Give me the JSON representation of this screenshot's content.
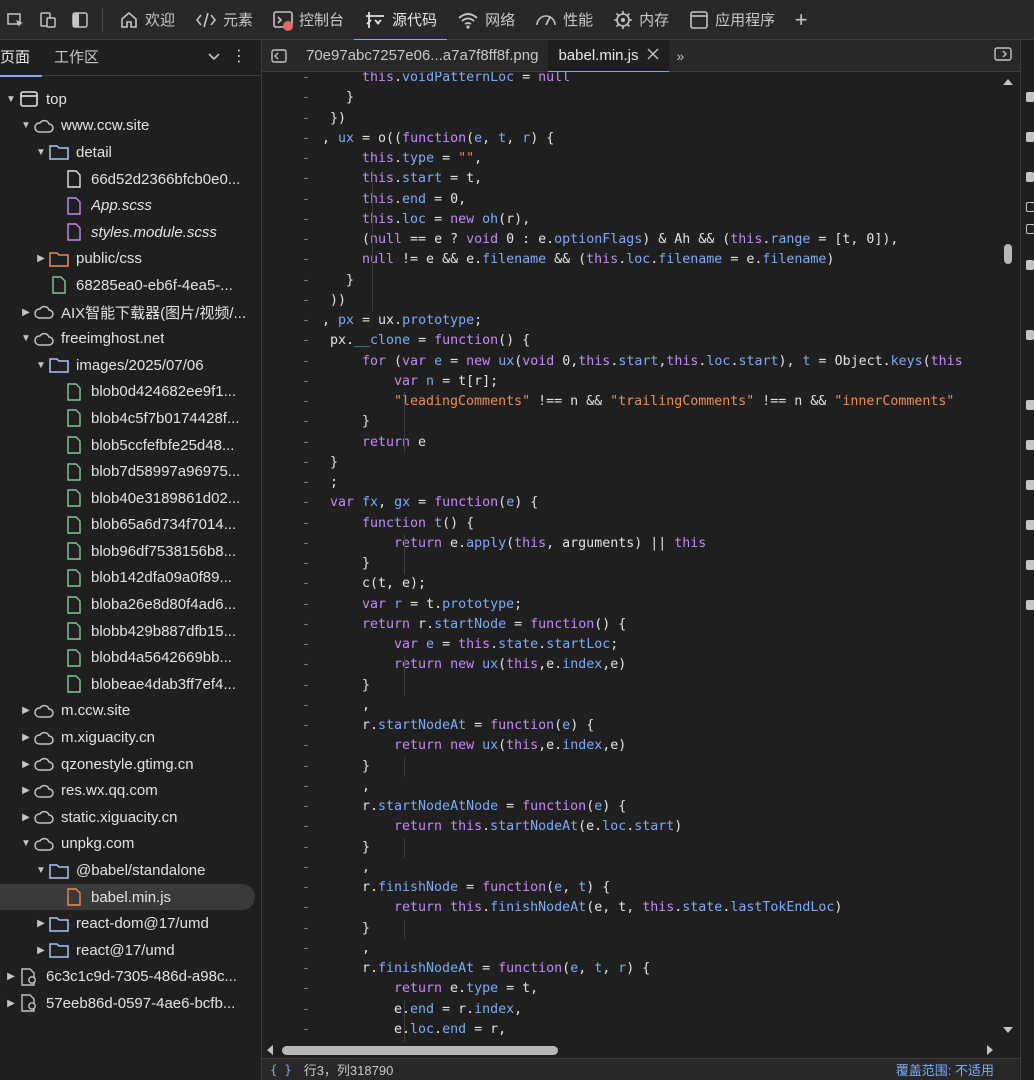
{
  "toolbar": {
    "tabs": [
      {
        "label": "欢迎",
        "icon": "home-icon"
      },
      {
        "label": "元素",
        "icon": "code-icon"
      },
      {
        "label": "控制台",
        "icon": "console-icon"
      },
      {
        "label": "源代码",
        "icon": "sources-icon",
        "active": true
      },
      {
        "label": "网络",
        "icon": "wifi-icon"
      },
      {
        "label": "性能",
        "icon": "performance-icon"
      },
      {
        "label": "内存",
        "icon": "memory-icon"
      },
      {
        "label": "应用程序",
        "icon": "application-icon"
      }
    ],
    "add_label": "+"
  },
  "navigator": {
    "tab_page": "页面",
    "tab_workspace": "工作区",
    "tree": [
      {
        "level": 0,
        "arrow": "open",
        "icon": "frame",
        "label": "top"
      },
      {
        "level": 1,
        "arrow": "open",
        "icon": "cloud",
        "label": "www.ccw.site"
      },
      {
        "level": 2,
        "arrow": "open",
        "icon": "folder",
        "label": "detail"
      },
      {
        "level": 3,
        "arrow": "",
        "icon": "file-white",
        "label": "66d52d2366bfcb0e0..."
      },
      {
        "level": 3,
        "arrow": "",
        "icon": "file-purple",
        "label": "App.scss",
        "italic": true
      },
      {
        "level": 3,
        "arrow": "",
        "icon": "file-purple",
        "label": "styles.module.scss",
        "italic": true
      },
      {
        "level": 2,
        "arrow": "closed",
        "icon": "folder-orange",
        "label": "public/css"
      },
      {
        "level": 2,
        "arrow": "",
        "icon": "file-green",
        "label": "68285ea0-eb6f-4ea5-..."
      },
      {
        "level": 1,
        "arrow": "closed",
        "icon": "cloud",
        "label": "AIX智能下载器(图片/视频/..."
      },
      {
        "level": 1,
        "arrow": "open",
        "icon": "cloud",
        "label": "freeimghost.net"
      },
      {
        "level": 2,
        "arrow": "open",
        "icon": "folder",
        "label": "images/2025/07/06"
      },
      {
        "level": 3,
        "arrow": "",
        "icon": "file-green",
        "label": "blob0d424682ee9f1..."
      },
      {
        "level": 3,
        "arrow": "",
        "icon": "file-green",
        "label": "blob4c5f7b0174428f..."
      },
      {
        "level": 3,
        "arrow": "",
        "icon": "file-green",
        "label": "blob5ccfefbfe25d48..."
      },
      {
        "level": 3,
        "arrow": "",
        "icon": "file-green",
        "label": "blob7d58997a96975..."
      },
      {
        "level": 3,
        "arrow": "",
        "icon": "file-green",
        "label": "blob40e3189861d02..."
      },
      {
        "level": 3,
        "arrow": "",
        "icon": "file-green",
        "label": "blob65a6d734f7014..."
      },
      {
        "level": 3,
        "arrow": "",
        "icon": "file-green",
        "label": "blob96df7538156b8..."
      },
      {
        "level": 3,
        "arrow": "",
        "icon": "file-green",
        "label": "blob142dfa09a0f89..."
      },
      {
        "level": 3,
        "arrow": "",
        "icon": "file-green",
        "label": "bloba26e8d80f4ad6..."
      },
      {
        "level": 3,
        "arrow": "",
        "icon": "file-green",
        "label": "blobb429b887dfb15..."
      },
      {
        "level": 3,
        "arrow": "",
        "icon": "file-green",
        "label": "blobd4a5642669bb..."
      },
      {
        "level": 3,
        "arrow": "",
        "icon": "file-green",
        "label": "blobeae4dab3ff7ef4..."
      },
      {
        "level": 1,
        "arrow": "closed",
        "icon": "cloud",
        "label": "m.ccw.site"
      },
      {
        "level": 1,
        "arrow": "closed",
        "icon": "cloud",
        "label": "m.xiguacity.cn"
      },
      {
        "level": 1,
        "arrow": "closed",
        "icon": "cloud",
        "label": "qzonestyle.gtimg.cn"
      },
      {
        "level": 1,
        "arrow": "closed",
        "icon": "cloud",
        "label": "res.wx.qq.com"
      },
      {
        "level": 1,
        "arrow": "closed",
        "icon": "cloud",
        "label": "static.xiguacity.cn"
      },
      {
        "level": 1,
        "arrow": "open",
        "icon": "cloud",
        "label": "unpkg.com"
      },
      {
        "level": 2,
        "arrow": "open",
        "icon": "folder",
        "label": "@babel/standalone"
      },
      {
        "level": 3,
        "arrow": "",
        "icon": "file-orange",
        "label": "babel.min.js",
        "selected": true
      },
      {
        "level": 2,
        "arrow": "closed",
        "icon": "folder",
        "label": "react-dom@17/umd"
      },
      {
        "level": 2,
        "arrow": "closed",
        "icon": "folder",
        "label": "react@17/umd"
      },
      {
        "level": 0,
        "arrow": "closed",
        "icon": "gear-file",
        "label": "6c3c1c9d-7305-486d-a98c..."
      },
      {
        "level": 0,
        "arrow": "closed",
        "icon": "gear-file",
        "label": "57eeb86d-0597-4ae6-bcfb..."
      }
    ]
  },
  "editor": {
    "tabs": [
      {
        "label": "70e97abc7257e06...a7a7f8ff8f.png",
        "active": false
      },
      {
        "label": "babel.min.js",
        "active": true,
        "closable": true
      }
    ],
    "more_label": "»",
    "gutter_mark": "-",
    "lines": [
      {
        "indent": 8,
        "html": "<span class='th'>this</span>.<span class='pr'>voidPatternLoc</span> = <span class='kw'>null</span>"
      },
      {
        "indent": 6,
        "html": "}"
      },
      {
        "indent": 4,
        "html": "})"
      },
      {
        "indent": 3,
        "html": ", <span class='pr'>ux</span> = o((<span class='kw'>function</span>(<span class='pr'>e</span>, <span class='pr'>t</span>, <span class='pr'>r</span>) {"
      },
      {
        "indent": 8,
        "html": "<span class='th'>this</span>.<span class='pr'>type</span> = <span class='st'>\"\"</span>,"
      },
      {
        "indent": 8,
        "html": "<span class='th'>this</span>.<span class='pr'>start</span> = t,"
      },
      {
        "indent": 8,
        "html": "<span class='th'>this</span>.<span class='pr'>end</span> = 0,"
      },
      {
        "indent": 8,
        "html": "<span class='th'>this</span>.<span class='pr'>loc</span> = <span class='kw'>new</span> <span class='pr'>oh</span>(r),"
      },
      {
        "indent": 8,
        "html": "(<span class='kw'>null</span> == e ? <span class='kw'>void</span> 0 : e.<span class='pr'>optionFlags</span>) &amp; Ah &amp;&amp; (<span class='th'>this</span>.<span class='pr'>range</span> = [t, 0]),"
      },
      {
        "indent": 8,
        "html": "<span class='kw'>null</span> != e &amp;&amp; e.<span class='pr'>filename</span> &amp;&amp; (<span class='th'>this</span>.<span class='pr'>loc</span>.<span class='pr'>filename</span> = e.<span class='pr'>filename</span>)"
      },
      {
        "indent": 6,
        "html": "}"
      },
      {
        "indent": 4,
        "html": "))"
      },
      {
        "indent": 3,
        "html": ", <span class='pr'>px</span> = ux.<span class='pr'>prototype</span>;"
      },
      {
        "indent": 4,
        "html": "px.<span class='pr'>__clone</span> = <span class='kw'>function</span>() {"
      },
      {
        "indent": 8,
        "html": "<span class='kw'>for</span> (<span class='kw'>var</span> <span class='pr'>e</span> = <span class='kw'>new</span> <span class='pr'>ux</span>(<span class='kw'>void</span> 0,<span class='th'>this</span>.<span class='pr'>start</span>,<span class='th'>this</span>.<span class='pr'>loc</span>.<span class='pr'>start</span>), <span class='pr'>t</span> = Object.<span class='pr'>keys</span>(<span class='th'>this</span>"
      },
      {
        "indent": 12,
        "html": "<span class='kw'>var</span> <span class='pr'>n</span> = t[r];"
      },
      {
        "indent": 12,
        "html": "<span class='st'>\"leadingComments\"</span> !== n &amp;&amp; <span class='st'>\"trailingComments\"</span> !== n &amp;&amp; <span class='st'>\"innerComments\"</span>"
      },
      {
        "indent": 8,
        "html": "}"
      },
      {
        "indent": 8,
        "html": "<span class='kw'>return</span> e"
      },
      {
        "indent": 4,
        "html": "}"
      },
      {
        "indent": 4,
        "html": ";"
      },
      {
        "indent": 4,
        "html": "<span class='kw'>var</span> <span class='pr'>fx</span>, <span class='pr'>gx</span> = <span class='kw'>function</span>(<span class='pr'>e</span>) {"
      },
      {
        "indent": 8,
        "html": "<span class='kw'>function</span> <span class='pr'>t</span>() {"
      },
      {
        "indent": 12,
        "html": "<span class='kw'>return</span> e.<span class='pr'>apply</span>(<span class='th'>this</span>, arguments) || <span class='th'>this</span>"
      },
      {
        "indent": 8,
        "html": "}"
      },
      {
        "indent": 8,
        "html": "c(t, e);"
      },
      {
        "indent": 8,
        "html": "<span class='kw'>var</span> <span class='pr'>r</span> = t.<span class='pr'>prototype</span>;"
      },
      {
        "indent": 8,
        "html": "<span class='kw'>return</span> r.<span class='pr'>startNode</span> = <span class='kw'>function</span>() {"
      },
      {
        "indent": 12,
        "html": "<span class='kw'>var</span> <span class='pr'>e</span> = <span class='th'>this</span>.<span class='pr'>state</span>.<span class='pr'>startLoc</span>;"
      },
      {
        "indent": 12,
        "html": "<span class='kw'>return</span> <span class='kw'>new</span> <span class='pr'>ux</span>(<span class='th'>this</span>,e.<span class='pr'>index</span>,e)"
      },
      {
        "indent": 8,
        "html": "}"
      },
      {
        "indent": 8,
        "html": ","
      },
      {
        "indent": 8,
        "html": "r.<span class='pr'>startNodeAt</span> = <span class='kw'>function</span>(<span class='pr'>e</span>) {"
      },
      {
        "indent": 12,
        "html": "<span class='kw'>return</span> <span class='kw'>new</span> <span class='pr'>ux</span>(<span class='th'>this</span>,e.<span class='pr'>index</span>,e)"
      },
      {
        "indent": 8,
        "html": "}"
      },
      {
        "indent": 8,
        "html": ","
      },
      {
        "indent": 8,
        "html": "r.<span class='pr'>startNodeAtNode</span> = <span class='kw'>function</span>(<span class='pr'>e</span>) {"
      },
      {
        "indent": 12,
        "html": "<span class='kw'>return</span> <span class='th'>this</span>.<span class='pr'>startNodeAt</span>(e.<span class='pr'>loc</span>.<span class='pr'>start</span>)"
      },
      {
        "indent": 8,
        "html": "}"
      },
      {
        "indent": 8,
        "html": ","
      },
      {
        "indent": 8,
        "html": "r.<span class='pr'>finishNode</span> = <span class='kw'>function</span>(<span class='pr'>e</span>, <span class='pr'>t</span>) {"
      },
      {
        "indent": 12,
        "html": "<span class='kw'>return</span> <span class='th'>this</span>.<span class='pr'>finishNodeAt</span>(e, t, <span class='th'>this</span>.<span class='pr'>state</span>.<span class='pr'>lastTokEndLoc</span>)"
      },
      {
        "indent": 8,
        "html": "}"
      },
      {
        "indent": 8,
        "html": ","
      },
      {
        "indent": 8,
        "html": "r.<span class='pr'>finishNodeAt</span> = <span class='kw'>function</span>(<span class='pr'>e</span>, <span class='pr'>t</span>, <span class='pr'>r</span>) {"
      },
      {
        "indent": 12,
        "html": "<span class='kw'>return</span> e.<span class='pr'>type</span> = t,"
      },
      {
        "indent": 12,
        "html": "e.<span class='pr'>end</span> = r.<span class='pr'>index</span>,"
      },
      {
        "indent": 12,
        "html": "e.<span class='pr'>loc</span>.<span class='pr'>end</span> = r,"
      }
    ]
  },
  "statusbar": {
    "braces": "{ }",
    "position": "行3，列318790",
    "coverage": "覆盖范围: 不适用"
  },
  "colors": {
    "accent": "#7cacf8",
    "keyword": "#c58af9",
    "string": "#f28b54",
    "folder": "#a8c7fa",
    "file_green": "#81c995",
    "file_purple": "#c58af9",
    "file_orange": "#f28b54"
  }
}
